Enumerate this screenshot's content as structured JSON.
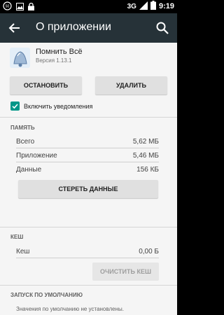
{
  "status_bar": {
    "network": "3G",
    "time": "9:19",
    "icons": [
      "notification-bubble-icon",
      "image-icon",
      "lock-icon",
      "signal-icon",
      "battery-icon"
    ]
  },
  "toolbar": {
    "title": "О приложении",
    "back_icon": "arrow-back-icon",
    "search_icon": "search-icon",
    "background": "#263238"
  },
  "app": {
    "name": "Помнить Всё",
    "version": "Версия 1.13.1",
    "icon": "bell-icon"
  },
  "buttons": {
    "stop": "ОСТАНОВИТЬ",
    "delete": "УДАЛИТЬ",
    "clear_data": "СТЕРЕТЬ ДАННЫЕ",
    "clear_cache": "ОЧИСТИТЬ КЕШ"
  },
  "notifications": {
    "label": "Включить уведомления",
    "checked": true,
    "accent": "#009688"
  },
  "memory": {
    "header": "ПАМЯТЬ",
    "rows": [
      {
        "label": "Всего",
        "value": "5,62 МБ"
      },
      {
        "label": "Приложение",
        "value": "5,46 МБ"
      },
      {
        "label": "Данные",
        "value": "156 КБ"
      }
    ]
  },
  "cache": {
    "header": "КЕШ",
    "rows": [
      {
        "label": "Кеш",
        "value": "0,00 Б"
      }
    ]
  },
  "defaults": {
    "header": "ЗАПУСК ПО УМОЛЧАНИЮ",
    "text": "Значения по умолчанию не установлены."
  }
}
